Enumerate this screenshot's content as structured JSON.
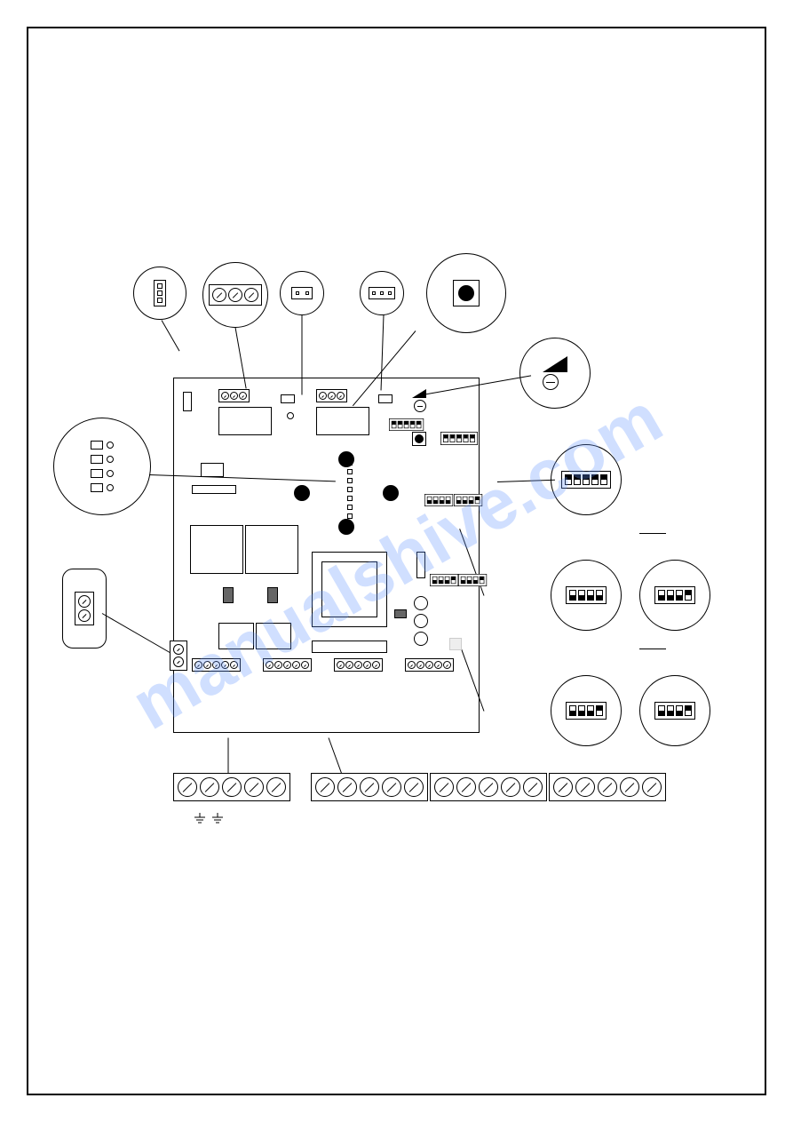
{
  "watermark": "manualshive.com",
  "callouts": {
    "c1": {
      "type": "3-pin-header-vertical"
    },
    "c2": {
      "type": "3-screw-terminal"
    },
    "c3": {
      "type": "2-pin-header"
    },
    "c4": {
      "type": "3-pin-header"
    },
    "c5": {
      "type": "push-button"
    },
    "c6": {
      "type": "potentiometer"
    },
    "c7": {
      "type": "5-pos-dip",
      "positions": [
        "on",
        "on",
        "on",
        "on",
        "on"
      ]
    },
    "c8_left": {
      "type": "4-pos-dip",
      "positions": [
        "off",
        "off",
        "off",
        "off"
      ]
    },
    "c8_right": {
      "type": "4-pos-dip",
      "positions": [
        "off",
        "off",
        "off",
        "on"
      ]
    },
    "c9_left": {
      "type": "4-pos-dip",
      "positions": [
        "off",
        "off",
        "off",
        "on"
      ]
    },
    "c9_right": {
      "type": "4-pos-dip",
      "positions": [
        "off",
        "off",
        "off",
        "on"
      ]
    },
    "c10": {
      "type": "4-led-indicator"
    },
    "c11": {
      "type": "2-screw-terminal-vertical"
    },
    "c12": {
      "type": "5-screw-terminal-large"
    },
    "c13": {
      "type": "15-screw-terminal-large-triple"
    }
  },
  "board_components": {
    "top_terminals": [
      "3-screw",
      "3-screw"
    ],
    "dip_blocks": [
      "5-pos",
      "4-pos",
      "4-pos",
      "4-pos",
      "4-pos"
    ],
    "buttons": 5,
    "bottom_terminal_rows": [
      5,
      5,
      5,
      5
    ]
  },
  "ground_symbols": 2
}
